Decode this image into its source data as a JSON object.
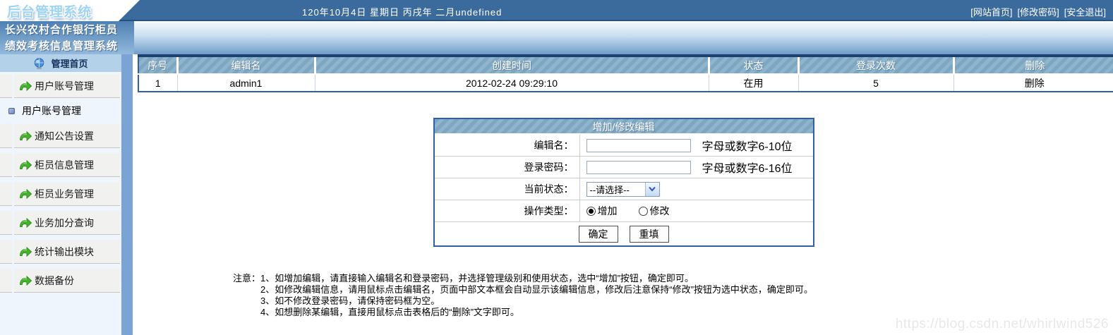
{
  "logo": "后台管理系统",
  "topbar": {
    "date_text": "120年10月4日 星期日 丙戌年 二月undefined",
    "links": [
      "[网站首页]",
      "[修改密码]",
      "[安全退出]"
    ]
  },
  "sidebar": {
    "title_line1": "长兴农村合作银行柜员",
    "title_line2": "绩效考核信息管理系统",
    "home_label": "管理首页",
    "items": [
      {
        "name": "user-account-mgmt",
        "label": "用户账号管理",
        "sub": [
          {
            "name": "user-account-mgmt-sub",
            "label": "用户账号管理"
          }
        ]
      },
      {
        "name": "notice-settings",
        "label": "通知公告设置"
      },
      {
        "name": "teller-info-mgmt",
        "label": "柜员信息管理"
      },
      {
        "name": "teller-business-mgmt",
        "label": "柜员业务管理"
      },
      {
        "name": "business-bonus-query",
        "label": "业务加分查询"
      },
      {
        "name": "stats-output-module",
        "label": "统计输出模块"
      },
      {
        "name": "data-backup",
        "label": "数据备份"
      }
    ]
  },
  "table": {
    "headers": [
      "序号",
      "编辑名",
      "创建时间",
      "状态",
      "登录次数",
      "删除"
    ],
    "rows": [
      {
        "index": "1",
        "editor": "admin1",
        "created": "2012-02-24 09:29:10",
        "status": "在用",
        "login_count": "5",
        "delete_label": "删除"
      }
    ]
  },
  "form": {
    "title": "增加/修改编辑",
    "editor_name": {
      "label": "编辑名：",
      "value": "",
      "hint": "字母或数字6-10位"
    },
    "password": {
      "label": "登录密码：",
      "value": "",
      "hint": "字母或数字6-16位"
    },
    "status": {
      "label": "当前状态：",
      "selected": "--请选择--"
    },
    "op_type": {
      "label": "操作类型：",
      "options": [
        {
          "label": "增加",
          "checked": true
        },
        {
          "label": "修改",
          "checked": false
        }
      ]
    },
    "submit_label": "确定",
    "reset_label": "重填"
  },
  "notes": {
    "prefix": "注意：",
    "lines": [
      "1、如增加编辑，请直接输入编辑名和登录密码，并选择管理级别和使用状态，选中“增加”按钮，确定即可。",
      "2、如修改编辑信息，请用鼠标点击编辑名，页面中部文本框会自动显示该编辑信息，修改后注意保持“修改”按钮为选中状态，确定即可。",
      "3、如不修改登录密码，请保持密码框为空。",
      "4、如想删除某编辑，直接用鼠标点击表格后的“删除”文字即可。"
    ]
  },
  "watermark": "https://blog.csdn.net/whirlwind526",
  "colors": {
    "topbar": "#3A6B9C",
    "table_border": "#2E5FA8",
    "table_border_dark": "#1B4173",
    "stripe_a": "#7FA6C1",
    "stripe_b": "#8FB5CD",
    "sidebar_strip": "#7BA3D4",
    "logo_text": "#9ED3F2",
    "home_row_bg": "#B3D1E9"
  }
}
